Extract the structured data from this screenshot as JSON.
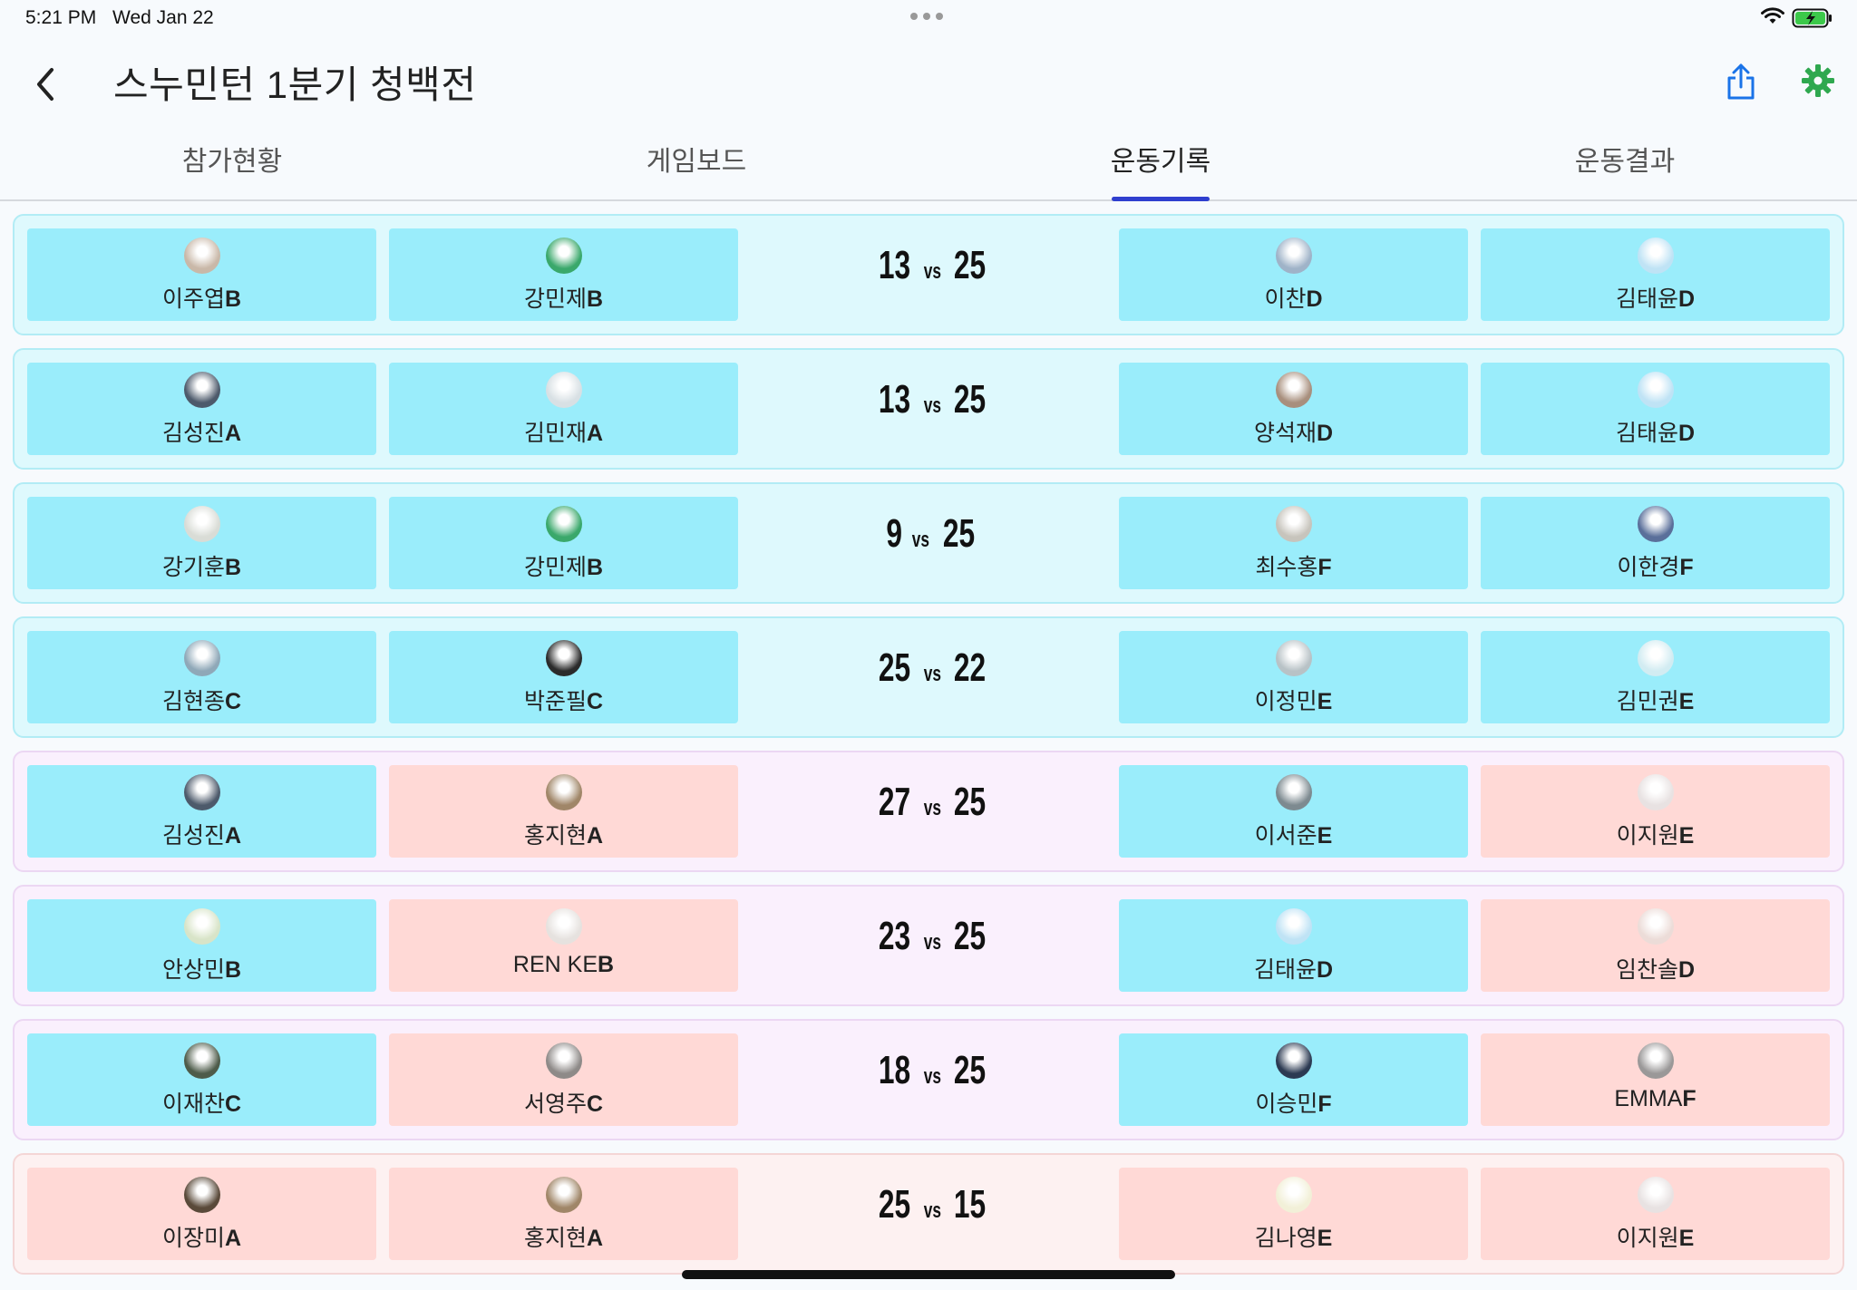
{
  "status_bar": {
    "time": "5:21 PM",
    "date": "Wed Jan 22"
  },
  "header": {
    "title": "스누민턴 1분기 청백전",
    "icons": {
      "back": "chevron-left-icon",
      "share": "share-icon",
      "settings": "gear-icon"
    },
    "colors": {
      "share": "#1a73e8",
      "settings": "#2fa84f"
    }
  },
  "tabs": [
    {
      "label": "참가현황",
      "active": false
    },
    {
      "label": "게임보드",
      "active": false
    },
    {
      "label": "운동기록",
      "active": true
    },
    {
      "label": "운동결과",
      "active": false
    }
  ],
  "colors": {
    "team_blue": "#9aedfb",
    "team_red": "#ffd9d6",
    "tab_active": "#2f3fcf"
  },
  "games": [
    {
      "style": "blue",
      "score_left": "13",
      "vs": "vs",
      "score_right": "25",
      "players": [
        {
          "name": "이주엽",
          "grade": "B",
          "team": "blue",
          "avatar": "#c9b8a8"
        },
        {
          "name": "강민제",
          "grade": "B",
          "team": "blue",
          "avatar": "#3aa86b"
        },
        {
          "name": "이찬",
          "grade": "D",
          "team": "blue",
          "avatar": "#9fb3c8"
        },
        {
          "name": "김태윤",
          "grade": "D",
          "team": "blue",
          "avatar": "#bfe3f5"
        }
      ]
    },
    {
      "style": "blue",
      "score_left": "13",
      "vs": "vs",
      "score_right": "25",
      "players": [
        {
          "name": "김성진",
          "grade": "A",
          "team": "blue",
          "avatar": "#4d5a6b"
        },
        {
          "name": "김민재",
          "grade": "A",
          "team": "blue",
          "avatar": "#d8e0e4"
        },
        {
          "name": "양석재",
          "grade": "D",
          "team": "blue",
          "avatar": "#a88f7d"
        },
        {
          "name": "김태윤",
          "grade": "D",
          "team": "blue",
          "avatar": "#bfe3f5"
        }
      ]
    },
    {
      "style": "blue",
      "score_left": "9",
      "vs": "vs",
      "score_right": "25",
      "players": [
        {
          "name": "강기훈",
          "grade": "B",
          "team": "blue",
          "avatar": "#d9dcd6"
        },
        {
          "name": "강민제",
          "grade": "B",
          "team": "blue",
          "avatar": "#3aa86b"
        },
        {
          "name": "최수홍",
          "grade": "F",
          "team": "blue",
          "avatar": "#c7c4bc"
        },
        {
          "name": "이한경",
          "grade": "F",
          "team": "blue",
          "avatar": "#5a6f9a"
        }
      ]
    },
    {
      "style": "blue",
      "score_left": "25",
      "vs": "vs",
      "score_right": "22",
      "players": [
        {
          "name": "김현종",
          "grade": "C",
          "team": "blue",
          "avatar": "#8fa8b8"
        },
        {
          "name": "박준필",
          "grade": "C",
          "team": "blue",
          "avatar": "#2b2b2b"
        },
        {
          "name": "이정민",
          "grade": "E",
          "team": "blue",
          "avatar": "#b8c2c6"
        },
        {
          "name": "김민권",
          "grade": "E",
          "team": "blue",
          "avatar": "#d2ecf2"
        }
      ]
    },
    {
      "style": "pink",
      "score_left": "27",
      "vs": "vs",
      "score_right": "25",
      "players": [
        {
          "name": "김성진",
          "grade": "A",
          "team": "blue",
          "avatar": "#4d5a6b"
        },
        {
          "name": "홍지현",
          "grade": "A",
          "team": "red",
          "avatar": "#a08668"
        },
        {
          "name": "이서준",
          "grade": "E",
          "team": "blue",
          "avatar": "#7d8a90"
        },
        {
          "name": "이지원",
          "grade": "E",
          "team": "red",
          "avatar": "#e8e2e2"
        }
      ]
    },
    {
      "style": "pink",
      "score_left": "23",
      "vs": "vs",
      "score_right": "25",
      "players": [
        {
          "name": "안상민",
          "grade": "B",
          "team": "blue",
          "avatar": "#d8e4c8"
        },
        {
          "name": "REN KE",
          "grade": "B",
          "team": "red",
          "avatar": "#e6e2df"
        },
        {
          "name": "김태윤",
          "grade": "D",
          "team": "blue",
          "avatar": "#bfe3f5"
        },
        {
          "name": "임찬솔",
          "grade": "D",
          "team": "red",
          "avatar": "#ecdcd8"
        }
      ]
    },
    {
      "style": "pink",
      "score_left": "18",
      "vs": "vs",
      "score_right": "25",
      "players": [
        {
          "name": "이재찬",
          "grade": "C",
          "team": "blue",
          "avatar": "#4e5c4a"
        },
        {
          "name": "서영주",
          "grade": "C",
          "team": "red",
          "avatar": "#8e8a88"
        },
        {
          "name": "이승민",
          "grade": "F",
          "team": "blue",
          "avatar": "#2c3a52"
        },
        {
          "name": "EMMA",
          "grade": "F",
          "team": "red",
          "avatar": "#9a9898"
        }
      ]
    },
    {
      "style": "peach",
      "score_left": "25",
      "vs": "vs",
      "score_right": "15",
      "players": [
        {
          "name": "이장미",
          "grade": "A",
          "team": "red",
          "avatar": "#5a4a3a"
        },
        {
          "name": "홍지현",
          "grade": "A",
          "team": "red",
          "avatar": "#a08668"
        },
        {
          "name": "김나영",
          "grade": "E",
          "team": "red",
          "avatar": "#f2f0d8"
        },
        {
          "name": "이지원",
          "grade": "E",
          "team": "red",
          "avatar": "#e8e2e2"
        }
      ]
    }
  ]
}
